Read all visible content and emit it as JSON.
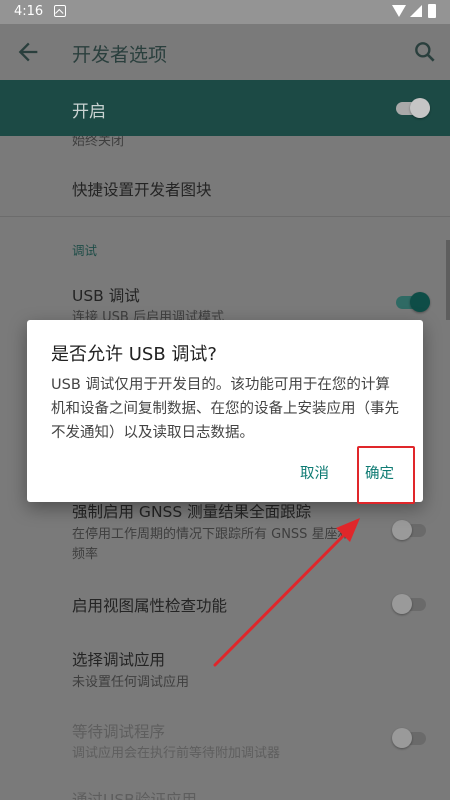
{
  "status_bar": {
    "time": "4:16"
  },
  "toolbar": {
    "title": "开发者选项"
  },
  "master": {
    "label": "开启",
    "enabled": true
  },
  "list": {
    "partial_top_text": "始终关闭",
    "quick_tiles": "快捷设置开发者图块",
    "section_debug": "调试",
    "usb_debug": {
      "title": "USB 调试",
      "subtitle": "连接 USB 后启用调试模式",
      "enabled": true
    },
    "gnss": {
      "title": "强制启用 GNSS 测量结果全面跟踪",
      "subtitle_line1": "在停用工作周期的情况下跟踪所有 GNSS 星座和",
      "subtitle_line2": "频率",
      "enabled": false
    },
    "view_attr": {
      "title": "启用视图属性检查功能",
      "enabled": false
    },
    "select_debug_app": {
      "title": "选择调试应用",
      "subtitle": "未设置任何调试应用"
    },
    "wait_debugger": {
      "title": "等待调试程序",
      "subtitle": "调试应用会在执行前等待附加调试器",
      "enabled": false
    },
    "partial_bottom_text": "通过USB验证应用"
  },
  "dialog": {
    "title": "是否允许 USB 调试?",
    "body": "USB 调试仅用于开发目的。该功能可用于在您的计算机和设备之间复制数据、在您的设备上安装应用（事先不发通知）以及读取日志数据。",
    "cancel_label": "取消",
    "ok_label": "确定"
  },
  "colors": {
    "accent": "#0e7b73",
    "annotation": "#e0262a",
    "master_bar": "#1c4a45"
  },
  "icons": {
    "back": "arrow-left-icon",
    "search": "search-icon",
    "notification": "notification-a-icon",
    "wifi": "wifi-icon",
    "signal": "cell-signal-icon",
    "battery": "battery-icon"
  }
}
